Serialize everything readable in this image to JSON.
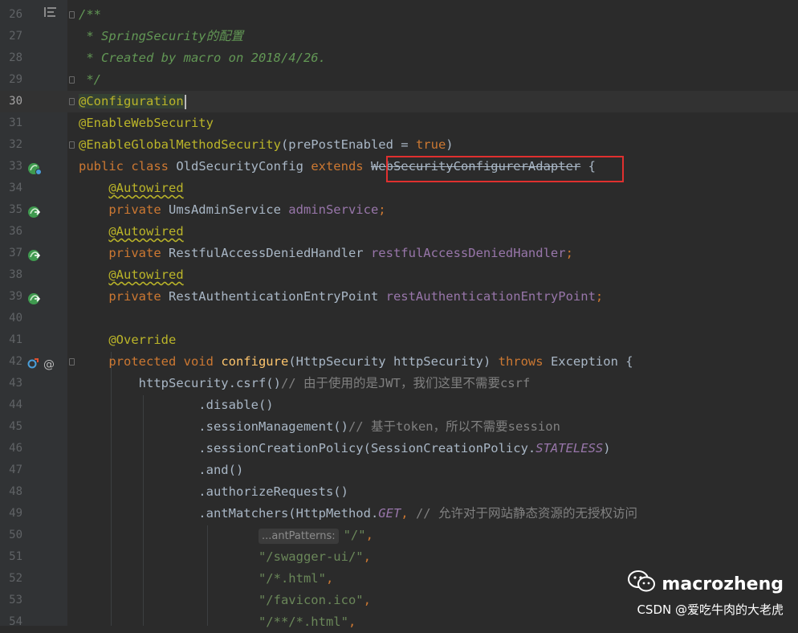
{
  "editor": {
    "lines": [
      {
        "num": "26",
        "tokens": [
          {
            "t": "comment",
            "v": "/**"
          }
        ]
      },
      {
        "num": "27",
        "tokens": [
          {
            "t": "comment",
            "v": " * SpringSecurity的配置"
          }
        ]
      },
      {
        "num": "28",
        "tokens": [
          {
            "t": "comment",
            "v": " * Created by macro on 2018/4/26."
          }
        ]
      },
      {
        "num": "29",
        "tokens": [
          {
            "t": "comment",
            "v": " */"
          }
        ]
      },
      {
        "num": "30",
        "current": true,
        "caret": true,
        "tokens": [
          {
            "t": "annotation",
            "v": "@Configuration",
            "hl": true
          }
        ]
      },
      {
        "num": "31",
        "tokens": [
          {
            "t": "annotation",
            "v": "@EnableWebSecurity"
          }
        ]
      },
      {
        "num": "32",
        "tokens": [
          {
            "t": "annotation",
            "v": "@EnableGlobalMethodSecurity"
          },
          {
            "t": "plain",
            "v": "(prePostEnabled = "
          },
          {
            "t": "keyword",
            "v": "true"
          },
          {
            "t": "plain",
            "v": ")"
          }
        ]
      },
      {
        "num": "33",
        "gutter": "class-icon",
        "tokens": [
          {
            "t": "keyword",
            "v": "public class "
          },
          {
            "t": "plain",
            "v": "OldSecurityConfig "
          },
          {
            "t": "keyword",
            "v": "extends "
          },
          {
            "t": "deprecated",
            "v": "WebSecurityConfigurerAdapter"
          },
          {
            "t": "plain",
            "v": " {"
          }
        ]
      },
      {
        "num": "34",
        "tokens": [
          {
            "t": "plain",
            "v": "    "
          },
          {
            "t": "annotation",
            "v": "@Autowired",
            "warn": true
          }
        ]
      },
      {
        "num": "35",
        "gutter": "bean-icon",
        "tokens": [
          {
            "t": "plain",
            "v": "    "
          },
          {
            "t": "keyword",
            "v": "private "
          },
          {
            "t": "plain",
            "v": "UmsAdminService "
          },
          {
            "t": "field",
            "v": "adminService"
          },
          {
            "t": "keyword",
            "v": ";"
          }
        ]
      },
      {
        "num": "36",
        "tokens": [
          {
            "t": "plain",
            "v": "    "
          },
          {
            "t": "annotation",
            "v": "@Autowired",
            "warn": true
          }
        ]
      },
      {
        "num": "37",
        "gutter": "bean-icon",
        "tokens": [
          {
            "t": "plain",
            "v": "    "
          },
          {
            "t": "keyword",
            "v": "private "
          },
          {
            "t": "plain",
            "v": "RestfulAccessDeniedHandler "
          },
          {
            "t": "field",
            "v": "restfulAccessDeniedHandler"
          },
          {
            "t": "keyword",
            "v": ";"
          }
        ]
      },
      {
        "num": "38",
        "tokens": [
          {
            "t": "plain",
            "v": "    "
          },
          {
            "t": "annotation",
            "v": "@Autowired",
            "warn": true
          }
        ]
      },
      {
        "num": "39",
        "gutter": "bean-icon",
        "tokens": [
          {
            "t": "plain",
            "v": "    "
          },
          {
            "t": "keyword",
            "v": "private "
          },
          {
            "t": "plain",
            "v": "RestAuthenticationEntryPoint "
          },
          {
            "t": "field",
            "v": "restAuthenticationEntryPoint"
          },
          {
            "t": "keyword",
            "v": ";"
          }
        ]
      },
      {
        "num": "40",
        "tokens": []
      },
      {
        "num": "41",
        "tokens": [
          {
            "t": "plain",
            "v": "    "
          },
          {
            "t": "annotation",
            "v": "@Override"
          }
        ]
      },
      {
        "num": "42",
        "gutter": "override-icon",
        "tokens": [
          {
            "t": "plain",
            "v": "    "
          },
          {
            "t": "keyword",
            "v": "protected void "
          },
          {
            "t": "method",
            "v": "configure"
          },
          {
            "t": "plain",
            "v": "(HttpSecurity httpSecurity) "
          },
          {
            "t": "keyword",
            "v": "throws "
          },
          {
            "t": "plain",
            "v": "Exception {"
          }
        ]
      },
      {
        "num": "43",
        "tokens": [
          {
            "t": "plain",
            "v": "        httpSecurity.csrf()"
          },
          {
            "t": "linecomment",
            "v": "// 由于使用的是JWT，我们这里不需要csrf"
          }
        ]
      },
      {
        "num": "44",
        "tokens": [
          {
            "t": "plain",
            "v": "                .disable()"
          }
        ]
      },
      {
        "num": "45",
        "tokens": [
          {
            "t": "plain",
            "v": "                .sessionManagement()"
          },
          {
            "t": "linecomment",
            "v": "// 基于token，所以不需要session"
          }
        ]
      },
      {
        "num": "46",
        "tokens": [
          {
            "t": "plain",
            "v": "                .sessionCreationPolicy(SessionCreationPolicy."
          },
          {
            "t": "static",
            "v": "STATELESS"
          },
          {
            "t": "plain",
            "v": ")"
          }
        ]
      },
      {
        "num": "47",
        "tokens": [
          {
            "t": "plain",
            "v": "                .and()"
          }
        ]
      },
      {
        "num": "48",
        "tokens": [
          {
            "t": "plain",
            "v": "                .authorizeRequests()"
          }
        ]
      },
      {
        "num": "49",
        "tokens": [
          {
            "t": "plain",
            "v": "                .antMatchers(HttpMethod."
          },
          {
            "t": "static",
            "v": "GET"
          },
          {
            "t": "keyword",
            "v": ", "
          },
          {
            "t": "linecomment",
            "v": "// 允许对于网站静态资源的无授权访问"
          }
        ]
      },
      {
        "num": "50",
        "tokens": [
          {
            "t": "plain",
            "v": "                        "
          },
          {
            "t": "hint",
            "v": "...antPatterns:"
          },
          {
            "t": "string",
            "v": "\"/\""
          },
          {
            "t": "keyword",
            "v": ","
          }
        ]
      },
      {
        "num": "51",
        "tokens": [
          {
            "t": "plain",
            "v": "                        "
          },
          {
            "t": "string",
            "v": "\"/swagger-ui/\""
          },
          {
            "t": "keyword",
            "v": ","
          }
        ]
      },
      {
        "num": "52",
        "tokens": [
          {
            "t": "plain",
            "v": "                        "
          },
          {
            "t": "string",
            "v": "\"/*.html\""
          },
          {
            "t": "keyword",
            "v": ","
          }
        ]
      },
      {
        "num": "53",
        "tokens": [
          {
            "t": "plain",
            "v": "                        "
          },
          {
            "t": "string",
            "v": "\"/favicon.ico\""
          },
          {
            "t": "keyword",
            "v": ","
          }
        ]
      },
      {
        "num": "54",
        "tokens": [
          {
            "t": "plain",
            "v": "                        "
          },
          {
            "t": "string",
            "v": "\"/**/*.html\""
          },
          {
            "t": "keyword",
            "v": ","
          }
        ]
      }
    ]
  },
  "watermark": {
    "brand": "macrozheng",
    "credit": "CSDN @爱吃牛肉的大老虎"
  },
  "colors": {
    "background": "#2b2b2b",
    "highlight_box": "#e0302f"
  }
}
